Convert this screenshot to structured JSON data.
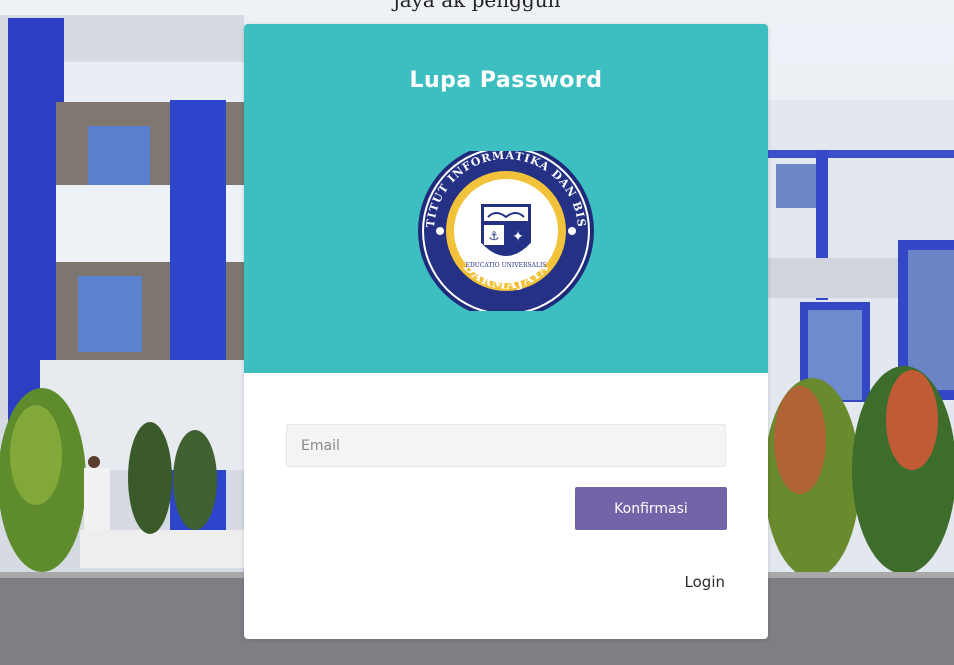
{
  "page": {
    "caption_fragment": "jaya      ak penggun",
    "colors": {
      "header": "#3dbfc2",
      "button": "#7463a9",
      "input_bg": "#f4f4f4",
      "card": "#ffffff"
    }
  },
  "card": {
    "title": "Lupa Password",
    "logo": {
      "icon": "darmajaya-seal-logo",
      "text_top": "INSTITUT INFORMATIKA DAN BISNIS",
      "motto": "EDUCATIO UNIVERSALIS",
      "text_bottom": "DARMAJAYA"
    },
    "form": {
      "email_placeholder": "Email",
      "email_value": "",
      "confirm_label": "Konfirmasi",
      "login_link": "Login"
    }
  }
}
